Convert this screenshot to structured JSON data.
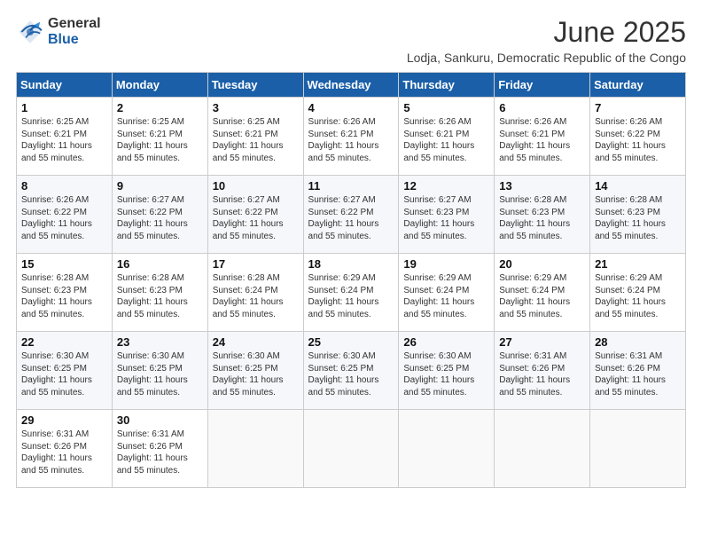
{
  "logo": {
    "general": "General",
    "blue": "Blue"
  },
  "title": "June 2025",
  "subtitle": "Lodja, Sankuru, Democratic Republic of the Congo",
  "headers": [
    "Sunday",
    "Monday",
    "Tuesday",
    "Wednesday",
    "Thursday",
    "Friday",
    "Saturday"
  ],
  "weeks": [
    [
      {
        "day": "1",
        "sunrise": "6:25 AM",
        "sunset": "6:21 PM",
        "daylight": "11 hours and 55 minutes."
      },
      {
        "day": "2",
        "sunrise": "6:25 AM",
        "sunset": "6:21 PM",
        "daylight": "11 hours and 55 minutes."
      },
      {
        "day": "3",
        "sunrise": "6:25 AM",
        "sunset": "6:21 PM",
        "daylight": "11 hours and 55 minutes."
      },
      {
        "day": "4",
        "sunrise": "6:26 AM",
        "sunset": "6:21 PM",
        "daylight": "11 hours and 55 minutes."
      },
      {
        "day": "5",
        "sunrise": "6:26 AM",
        "sunset": "6:21 PM",
        "daylight": "11 hours and 55 minutes."
      },
      {
        "day": "6",
        "sunrise": "6:26 AM",
        "sunset": "6:21 PM",
        "daylight": "11 hours and 55 minutes."
      },
      {
        "day": "7",
        "sunrise": "6:26 AM",
        "sunset": "6:22 PM",
        "daylight": "11 hours and 55 minutes."
      }
    ],
    [
      {
        "day": "8",
        "sunrise": "6:26 AM",
        "sunset": "6:22 PM",
        "daylight": "11 hours and 55 minutes."
      },
      {
        "day": "9",
        "sunrise": "6:27 AM",
        "sunset": "6:22 PM",
        "daylight": "11 hours and 55 minutes."
      },
      {
        "day": "10",
        "sunrise": "6:27 AM",
        "sunset": "6:22 PM",
        "daylight": "11 hours and 55 minutes."
      },
      {
        "day": "11",
        "sunrise": "6:27 AM",
        "sunset": "6:22 PM",
        "daylight": "11 hours and 55 minutes."
      },
      {
        "day": "12",
        "sunrise": "6:27 AM",
        "sunset": "6:23 PM",
        "daylight": "11 hours and 55 minutes."
      },
      {
        "day": "13",
        "sunrise": "6:28 AM",
        "sunset": "6:23 PM",
        "daylight": "11 hours and 55 minutes."
      },
      {
        "day": "14",
        "sunrise": "6:28 AM",
        "sunset": "6:23 PM",
        "daylight": "11 hours and 55 minutes."
      }
    ],
    [
      {
        "day": "15",
        "sunrise": "6:28 AM",
        "sunset": "6:23 PM",
        "daylight": "11 hours and 55 minutes."
      },
      {
        "day": "16",
        "sunrise": "6:28 AM",
        "sunset": "6:23 PM",
        "daylight": "11 hours and 55 minutes."
      },
      {
        "day": "17",
        "sunrise": "6:28 AM",
        "sunset": "6:24 PM",
        "daylight": "11 hours and 55 minutes."
      },
      {
        "day": "18",
        "sunrise": "6:29 AM",
        "sunset": "6:24 PM",
        "daylight": "11 hours and 55 minutes."
      },
      {
        "day": "19",
        "sunrise": "6:29 AM",
        "sunset": "6:24 PM",
        "daylight": "11 hours and 55 minutes."
      },
      {
        "day": "20",
        "sunrise": "6:29 AM",
        "sunset": "6:24 PM",
        "daylight": "11 hours and 55 minutes."
      },
      {
        "day": "21",
        "sunrise": "6:29 AM",
        "sunset": "6:24 PM",
        "daylight": "11 hours and 55 minutes."
      }
    ],
    [
      {
        "day": "22",
        "sunrise": "6:30 AM",
        "sunset": "6:25 PM",
        "daylight": "11 hours and 55 minutes."
      },
      {
        "day": "23",
        "sunrise": "6:30 AM",
        "sunset": "6:25 PM",
        "daylight": "11 hours and 55 minutes."
      },
      {
        "day": "24",
        "sunrise": "6:30 AM",
        "sunset": "6:25 PM",
        "daylight": "11 hours and 55 minutes."
      },
      {
        "day": "25",
        "sunrise": "6:30 AM",
        "sunset": "6:25 PM",
        "daylight": "11 hours and 55 minutes."
      },
      {
        "day": "26",
        "sunrise": "6:30 AM",
        "sunset": "6:25 PM",
        "daylight": "11 hours and 55 minutes."
      },
      {
        "day": "27",
        "sunrise": "6:31 AM",
        "sunset": "6:26 PM",
        "daylight": "11 hours and 55 minutes."
      },
      {
        "day": "28",
        "sunrise": "6:31 AM",
        "sunset": "6:26 PM",
        "daylight": "11 hours and 55 minutes."
      }
    ],
    [
      {
        "day": "29",
        "sunrise": "6:31 AM",
        "sunset": "6:26 PM",
        "daylight": "11 hours and 55 minutes."
      },
      {
        "day": "30",
        "sunrise": "6:31 AM",
        "sunset": "6:26 PM",
        "daylight": "11 hours and 55 minutes."
      },
      null,
      null,
      null,
      null,
      null
    ]
  ],
  "day_label_sunrise": "Sunrise:",
  "day_label_sunset": "Sunset:",
  "day_label_daylight": "Daylight:"
}
